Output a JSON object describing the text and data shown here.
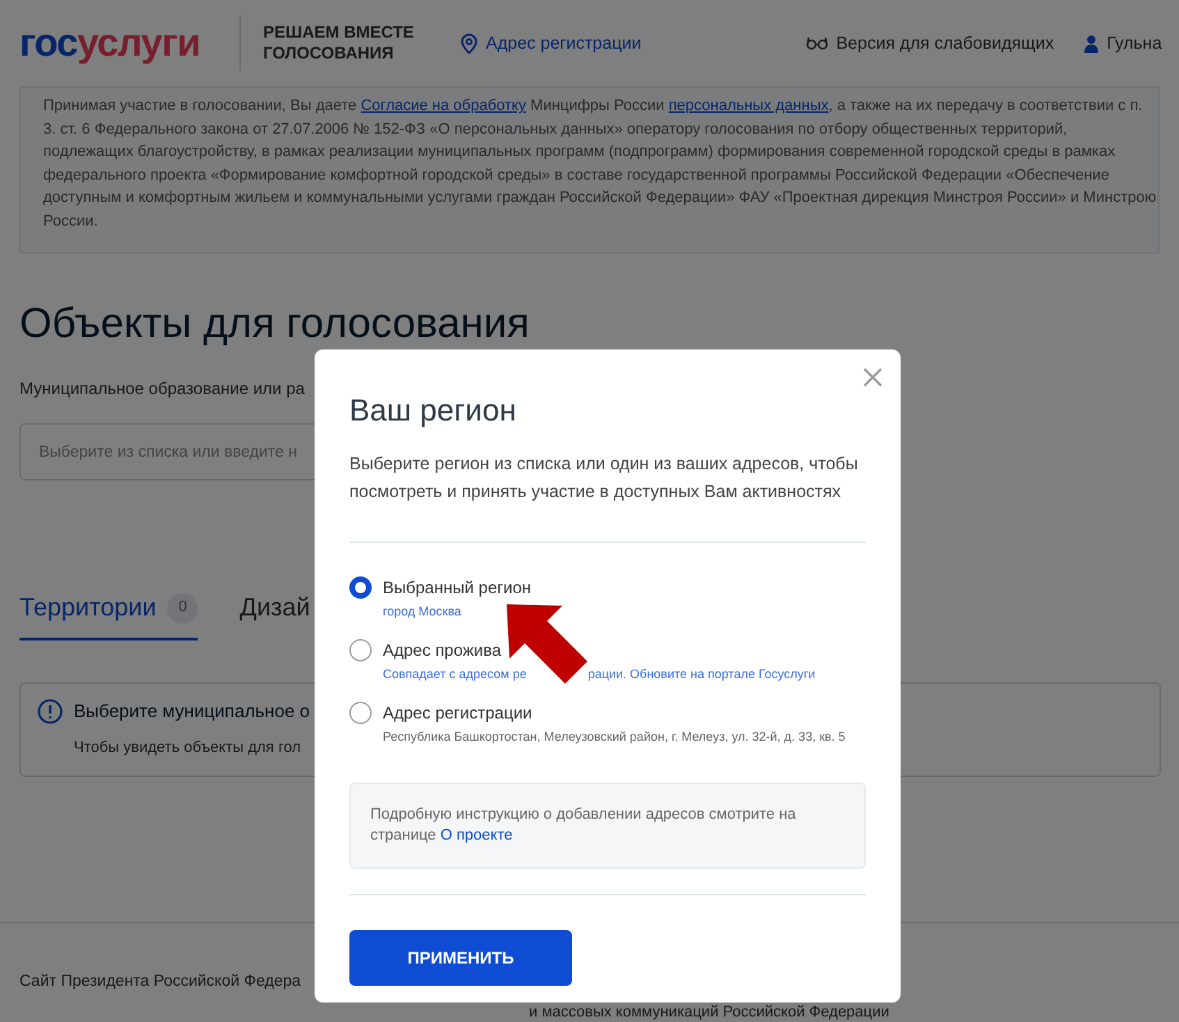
{
  "header": {
    "logo": [
      "гос",
      "услуги"
    ],
    "project": "РЕШАЕМ ВМЕСТЕ ГОЛОСОВАНИЯ",
    "address_link": "Адрес регистрации",
    "accessibility": "Версия для слабовидящих",
    "user": "Гульна"
  },
  "consent": [
    {
      "kind": "text",
      "text": "Принимая участие в голосовании, Вы даете "
    },
    {
      "kind": "link",
      "text": "Согласие на обработку"
    },
    {
      "kind": "text",
      "text": " Минцифры России "
    },
    {
      "kind": "link",
      "text": "персональных данных"
    },
    {
      "kind": "text",
      "text": ", а также на их передачу в соответствии с п. 3. ст. 6 Федерального закона от 27.07.2006 № 152-ФЗ «О персональных данных» оператору голосования по отбору общественных территорий, подлежащих благоустройству, в рамках реализации муниципальных программ (подпрограмм) формирования современной городской среды в рамках федерального проекта «Формирование комфортной городской среды» в составе государственной программы Российской Федерации «Обеспечение доступным и комфортным жильем и коммунальными услугами граждан Российской Федерации» ФАУ «Проектная дирекция Минстроя России» и Минстрою России."
    }
  ],
  "page_title": "Объекты для голосования",
  "municipality": {
    "label": "Муниципальное образование или ра",
    "placeholder": "Выберите из списка или введите н"
  },
  "tabs": [
    {
      "label": "Территории",
      "count": "0",
      "selected": true
    },
    {
      "label": "Дизай",
      "selected": false
    }
  ],
  "notice": {
    "title": "Выберите муниципальное о",
    "text": "Чтобы увидеть объекты для гол"
  },
  "footer": [
    "Сайт Президента Российской Федера",
    "и массовых коммуникаций Российской Федерации"
  ],
  "modal": {
    "title": "Ваш регион",
    "description": "Выберите регион из списка или один из ваших адресов, чтобы посмотреть и принять участие в доступных Вам активностях",
    "options": [
      {
        "kind": "link",
        "label": "Выбранный регион",
        "selected": true,
        "detail": [
          "город Москва"
        ]
      },
      {
        "kind": "link",
        "label": "Адрес прожива",
        "selected": false,
        "detail": [
          "Совпадает с адресом ре",
          "рации. Обновите на портале Госуслуги"
        ]
      },
      {
        "kind": "plain",
        "label": "Адрес регистрации",
        "selected": false,
        "detail": [
          "Республика Башкортостан, Мелеузовский район, г. Мелеуз, ул. 32-й, д. 33, кв. 5"
        ]
      }
    ],
    "hint": "Подробную инструкцию о добавлении адресов смотрите на странице",
    "hint_link": "О проекте",
    "button": "ПРИМЕНИТЬ"
  }
}
